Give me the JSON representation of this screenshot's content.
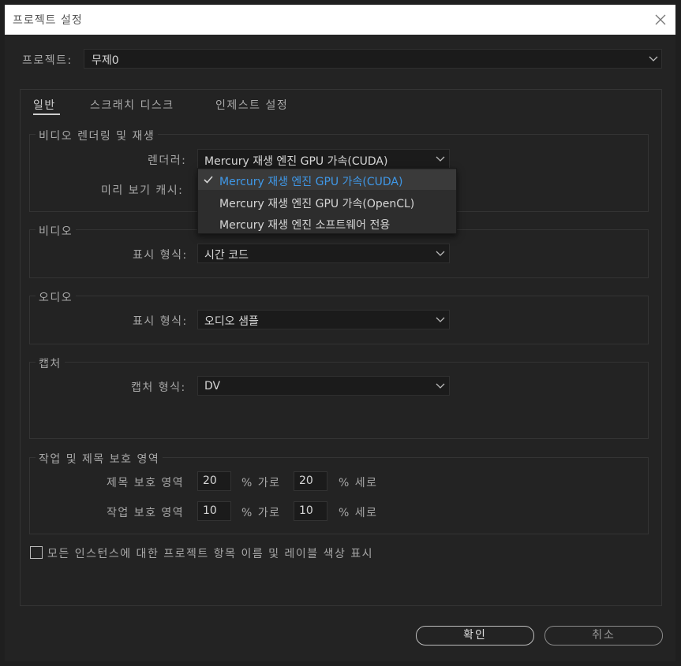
{
  "window": {
    "title": "프로젝트 설정"
  },
  "project": {
    "label": "프로젝트:",
    "value": "무제0"
  },
  "tabs": [
    {
      "label": "일반",
      "active": true
    },
    {
      "label": "스크래치 디스크",
      "active": false
    },
    {
      "label": "인제스트 설정",
      "active": false
    }
  ],
  "video_rendering": {
    "title": "비디오 렌더링 및 재생",
    "renderer_label": "렌더러:",
    "renderer_value": "Mercury 재생 엔진 GPU 가속(CUDA)",
    "preview_cache_label": "미리 보기 캐시:",
    "menu_items": [
      {
        "label": "Mercury 재생 엔진 GPU 가속(CUDA)",
        "checked": true
      },
      {
        "label": "Mercury 재생 엔진 GPU 가속(OpenCL)",
        "checked": false
      },
      {
        "label": "Mercury 재생 엔진 소프트웨어 전용",
        "checked": false
      }
    ]
  },
  "video": {
    "title": "비디오",
    "format_label": "표시 형식:",
    "format_value": "시간 코드"
  },
  "audio": {
    "title": "오디오",
    "format_label": "표시 형식:",
    "format_value": "오디오 샘플"
  },
  "capture": {
    "title": "캡처",
    "format_label": "캡처 형식:",
    "format_value": "DV"
  },
  "safe_areas": {
    "title": "작업 및 제목 보호 영역",
    "title_safe_label": "제목 보호 영역",
    "title_h": "20",
    "title_v": "20",
    "action_safe_label": "작업 보호 영역",
    "action_h": "10",
    "action_v": "10",
    "h_unit": "% 가로",
    "v_unit": "% 세로"
  },
  "display_names_checkbox": {
    "label": "모든 인스턴스에 대한 프로젝트 항목 이름 및 레이블 색상 표시",
    "checked": false
  },
  "buttons": {
    "ok": "확인",
    "cancel": "취소"
  },
  "colors": {
    "accent": "#3f98e8",
    "background": "#232323",
    "field": "#1b1b1b"
  }
}
